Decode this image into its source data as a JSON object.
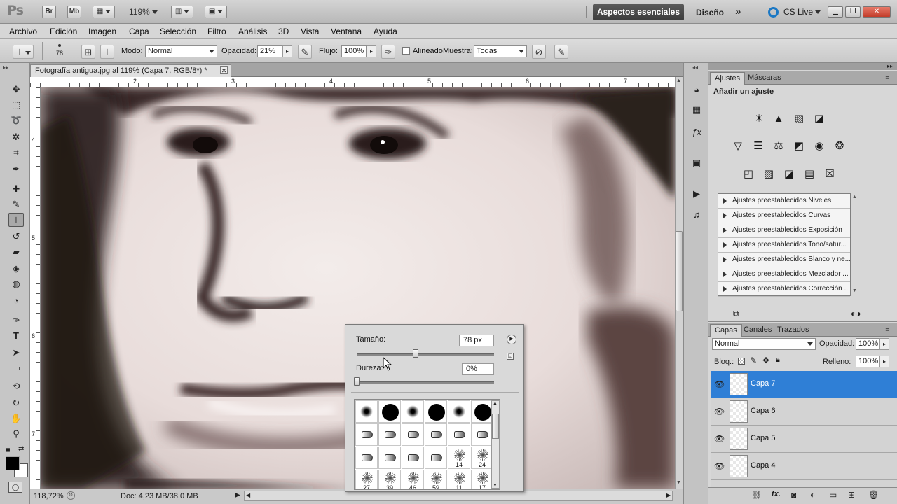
{
  "appbar": {
    "logo": "Ps",
    "bridge": "Br",
    "mini_bridge": "Mb",
    "zoom": "119%",
    "workspace_active": "Aspectos esenciales",
    "workspace_design": "Diseño",
    "more": "»",
    "cs_live": "CS Live"
  },
  "menu": [
    "Archivo",
    "Edición",
    "Imagen",
    "Capa",
    "Selección",
    "Filtro",
    "Análisis",
    "3D",
    "Vista",
    "Ventana",
    "Ayuda"
  ],
  "options": {
    "brush_size": "78",
    "mode_label": "Modo:",
    "mode_value": "Normal",
    "opacity_label": "Opacidad:",
    "opacity_value": "21%",
    "flow_label": "Flujo:",
    "flow_value": "100%",
    "aligned_label": "Alineado",
    "sample_label": "Muestra:",
    "sample_value": "Todas"
  },
  "document": {
    "tab_title": "Fotografía antigua.jpg al 119% (Capa 7, RGB/8*) *",
    "ruler_top": [
      "2",
      "3",
      "4",
      "5",
      "6",
      "7"
    ],
    "ruler_left": [
      "4",
      "5",
      "6",
      "7"
    ],
    "zoom_status": "118,72%",
    "doc_size": "Doc: 4,23 MB/38,0 MB"
  },
  "brush_popup": {
    "size_label": "Tamaño:",
    "size_value": "78 px",
    "size_level": 0.43,
    "hardness_label": "Dureza:",
    "hardness_value": "0%",
    "hardness_level": 0.0,
    "brushes": [
      {
        "kind": "soft",
        "num": ""
      },
      {
        "kind": "hard",
        "num": ""
      },
      {
        "kind": "soft",
        "num": ""
      },
      {
        "kind": "hard",
        "num": ""
      },
      {
        "kind": "soft",
        "num": ""
      },
      {
        "kind": "hard",
        "num": ""
      },
      {
        "kind": "tip",
        "num": ""
      },
      {
        "kind": "tip",
        "num": ""
      },
      {
        "kind": "tip",
        "num": ""
      },
      {
        "kind": "tip",
        "num": ""
      },
      {
        "kind": "tip",
        "num": ""
      },
      {
        "kind": "tip",
        "num": ""
      },
      {
        "kind": "tip",
        "num": ""
      },
      {
        "kind": "tip",
        "num": ""
      },
      {
        "kind": "tip",
        "num": ""
      },
      {
        "kind": "tip",
        "num": ""
      },
      {
        "kind": "splat",
        "num": "14"
      },
      {
        "kind": "splat",
        "num": "24"
      },
      {
        "kind": "splat",
        "num": "27"
      },
      {
        "kind": "splat",
        "num": "39"
      },
      {
        "kind": "splat",
        "num": "46"
      },
      {
        "kind": "splat",
        "num": "59"
      },
      {
        "kind": "splat",
        "num": "11"
      },
      {
        "kind": "splat",
        "num": "17"
      }
    ]
  },
  "adjustments": {
    "tab_adjust": "Ajustes",
    "tab_masks": "Máscaras",
    "heading": "Añadir un ajuste",
    "presets": [
      "Ajustes preestablecidos Niveles",
      "Ajustes preestablecidos Curvas",
      "Ajustes preestablecidos Exposición",
      "Ajustes preestablecidos Tono/satur...",
      "Ajustes preestablecidos Blanco y ne...",
      "Ajustes preestablecidos Mezclador ...",
      "Ajustes preestablecidos Corrección ..."
    ]
  },
  "layers": {
    "tab_layers": "Capas",
    "tab_channels": "Canales",
    "tab_paths": "Trazados",
    "blend_mode": "Normal",
    "opacity_label": "Opacidad:",
    "opacity_value": "100%",
    "lock_label": "Bloq.:",
    "fill_label": "Relleno:",
    "fill_value": "100%",
    "items": [
      {
        "name": "Capa 7",
        "selected": true
      },
      {
        "name": "Capa 6",
        "selected": false
      },
      {
        "name": "Capa 5",
        "selected": false
      },
      {
        "name": "Capa 4",
        "selected": false
      }
    ]
  }
}
